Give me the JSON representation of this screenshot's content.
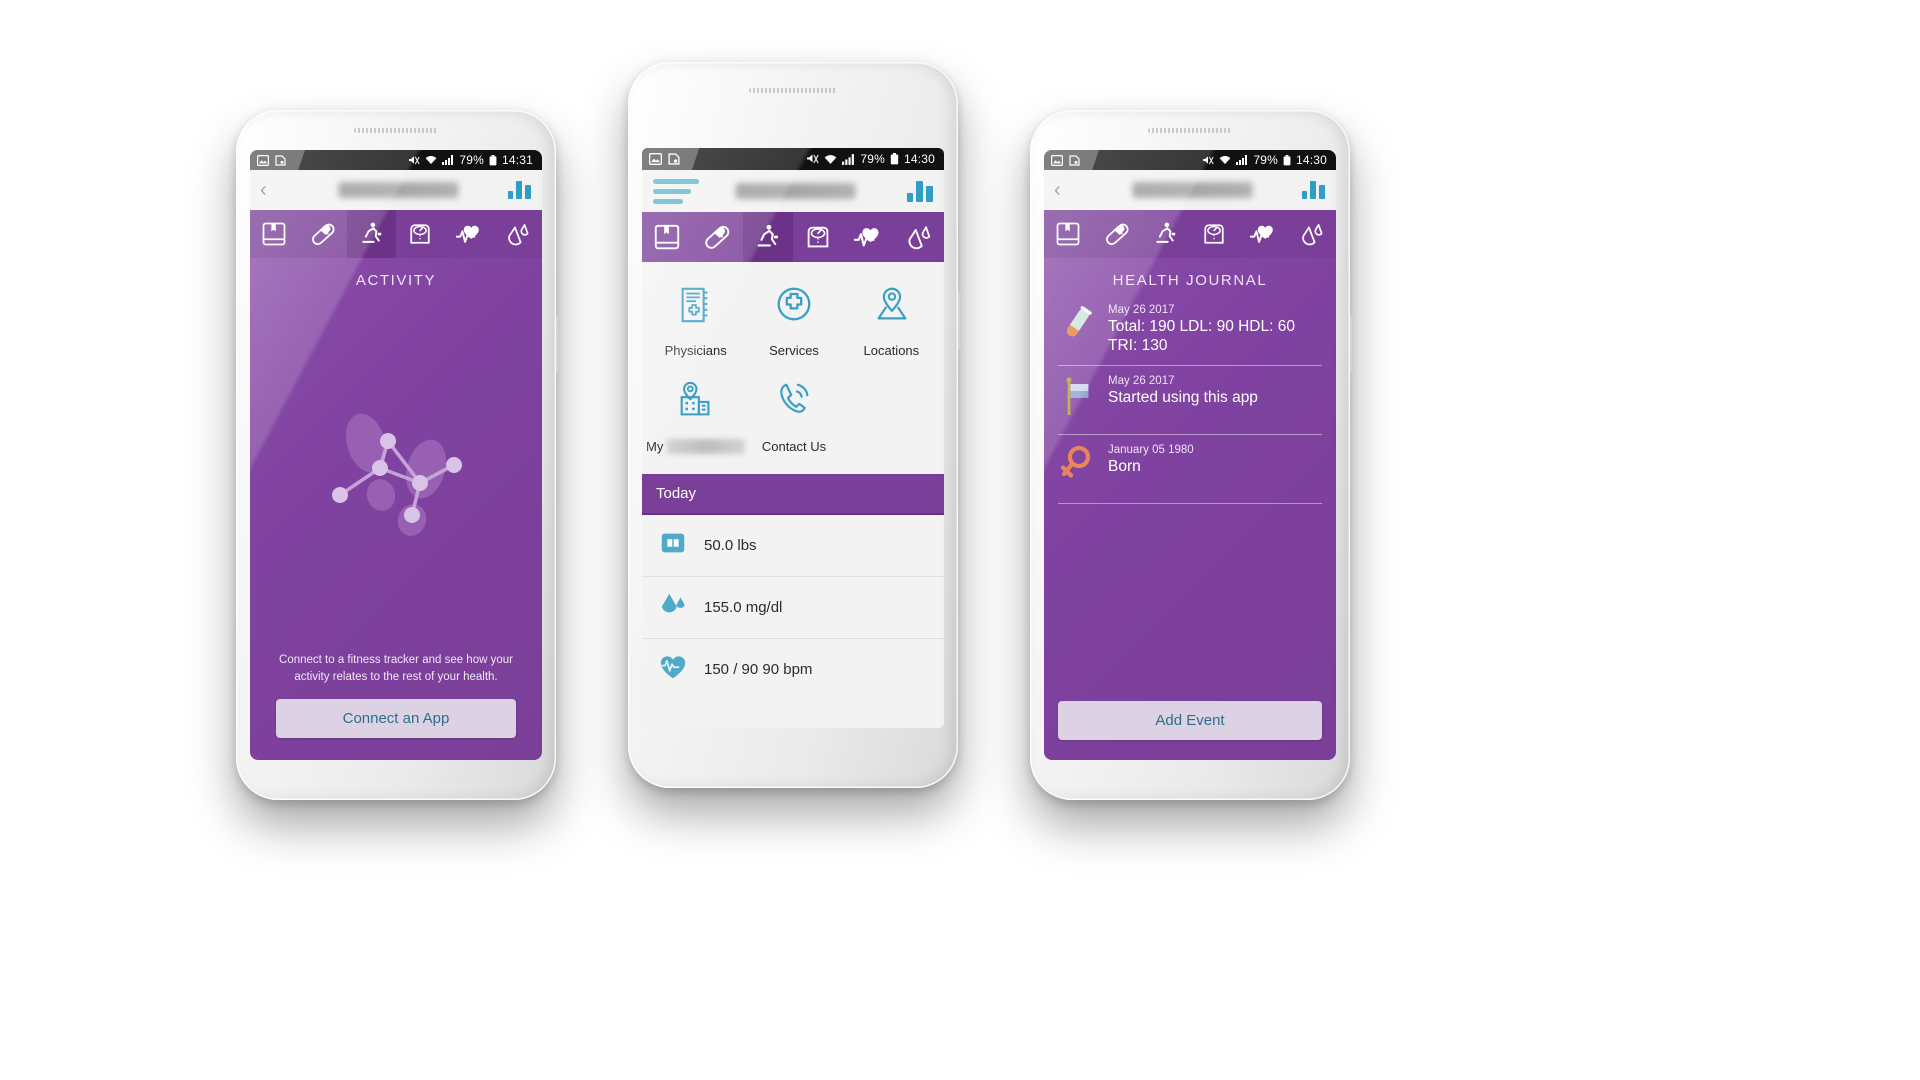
{
  "page": {
    "background": "#ffffff",
    "accent_purple": "#7a3f98",
    "accent_teal": "#3a9fc4",
    "button_text_color": "#2c6f8c"
  },
  "phones": [
    {
      "id": "left",
      "status": {
        "time": "14:31",
        "battery": "79%",
        "icons": [
          "gallery-icon",
          "screenshot-icon",
          "mute-icon",
          "wifi-icon",
          "signal-icon",
          "battery-icon"
        ]
      },
      "header": {
        "back": "‹",
        "logo_redacted": true,
        "chart_icon": "bar-chart-icon"
      },
      "nav": {
        "active_index": 2,
        "tabs": [
          "journal",
          "medication",
          "activity",
          "weight",
          "vitals",
          "labs"
        ]
      },
      "screen": {
        "title": "ACTIVITY",
        "hint": "Connect to a fitness tracker and see how your activity relates to the rest of your health.",
        "button": "Connect an App",
        "illustration": "footprints-network-icon"
      }
    },
    {
      "id": "center",
      "status": {
        "time": "14:30",
        "battery": "79%",
        "icons": [
          "gallery-icon",
          "screenshot-icon",
          "mute-icon",
          "wifi-icon",
          "signal-icon",
          "battery-icon"
        ]
      },
      "header": {
        "menu": "hamburger-icon",
        "logo_redacted": true,
        "chart_icon": "bar-chart-icon"
      },
      "nav": {
        "active_index": 2,
        "tabs": [
          "journal",
          "medication",
          "activity",
          "weight",
          "vitals",
          "labs"
        ]
      },
      "services": [
        {
          "label": "Physicians",
          "icon": "physician-directory-icon",
          "redacted": false
        },
        {
          "label": "Services",
          "icon": "medical-cross-circle-icon",
          "redacted": false
        },
        {
          "label": "Locations",
          "icon": "map-pin-icon",
          "redacted": false
        },
        {
          "label": "My",
          "icon": "hospital-pin-icon",
          "redacted": true
        },
        {
          "label": "Contact Us",
          "icon": "phone-call-icon",
          "redacted": false
        }
      ],
      "today": {
        "header": "Today",
        "rows": [
          {
            "icon": "scale-icon",
            "value": "50.0 lbs"
          },
          {
            "icon": "droplet-icon",
            "value": "155.0 mg/dl"
          },
          {
            "icon": "heart-pulse-icon",
            "value": "150 / 90  90 bpm"
          }
        ]
      }
    },
    {
      "id": "right",
      "status": {
        "time": "14:30",
        "battery": "79%",
        "icons": [
          "gallery-icon",
          "screenshot-icon",
          "mute-icon",
          "wifi-icon",
          "signal-icon",
          "battery-icon"
        ]
      },
      "header": {
        "back": "‹",
        "logo_redacted": true,
        "chart_icon": "bar-chart-icon"
      },
      "nav": {
        "active_index": 0,
        "tabs": [
          "journal",
          "medication",
          "activity",
          "weight",
          "vitals",
          "labs"
        ]
      },
      "screen": {
        "title": "HEALTH JOURNAL",
        "entries": [
          {
            "icon": "test-tube-icon",
            "date": "May 26 2017",
            "text": "Total: 190  LDL: 90 HDL: 60\nTRI: 130"
          },
          {
            "icon": "flag-icon",
            "date": "May 26 2017",
            "text": "Started using this app"
          },
          {
            "icon": "female-sign-icon",
            "date": "January 05 1980",
            "text": "Born"
          }
        ],
        "button": "Add Event"
      }
    }
  ]
}
